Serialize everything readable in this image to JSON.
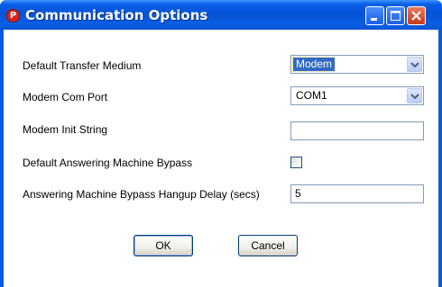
{
  "window": {
    "title": "Communication Options",
    "app_icon_glyph": "P",
    "controls": [
      "minimize-icon",
      "maximize-icon",
      "close-icon"
    ]
  },
  "form": {
    "transfer_medium": {
      "label": "Default Transfer Medium",
      "value": "Modem"
    },
    "com_port": {
      "label": "Modem Com Port",
      "value": "COM1"
    },
    "init_string": {
      "label": "Modem Init String",
      "value": ""
    },
    "bypass": {
      "label": "Default Answering Machine Bypass",
      "checked": false
    },
    "hangup_delay": {
      "label": "Answering Machine Bypass Hangup Delay (secs)",
      "value": "5"
    }
  },
  "buttons": {
    "ok": "OK",
    "cancel": "Cancel"
  },
  "colors": {
    "titlebar": "#0553d6",
    "selection": "#316ac5",
    "field_border": "#7f9db9"
  }
}
